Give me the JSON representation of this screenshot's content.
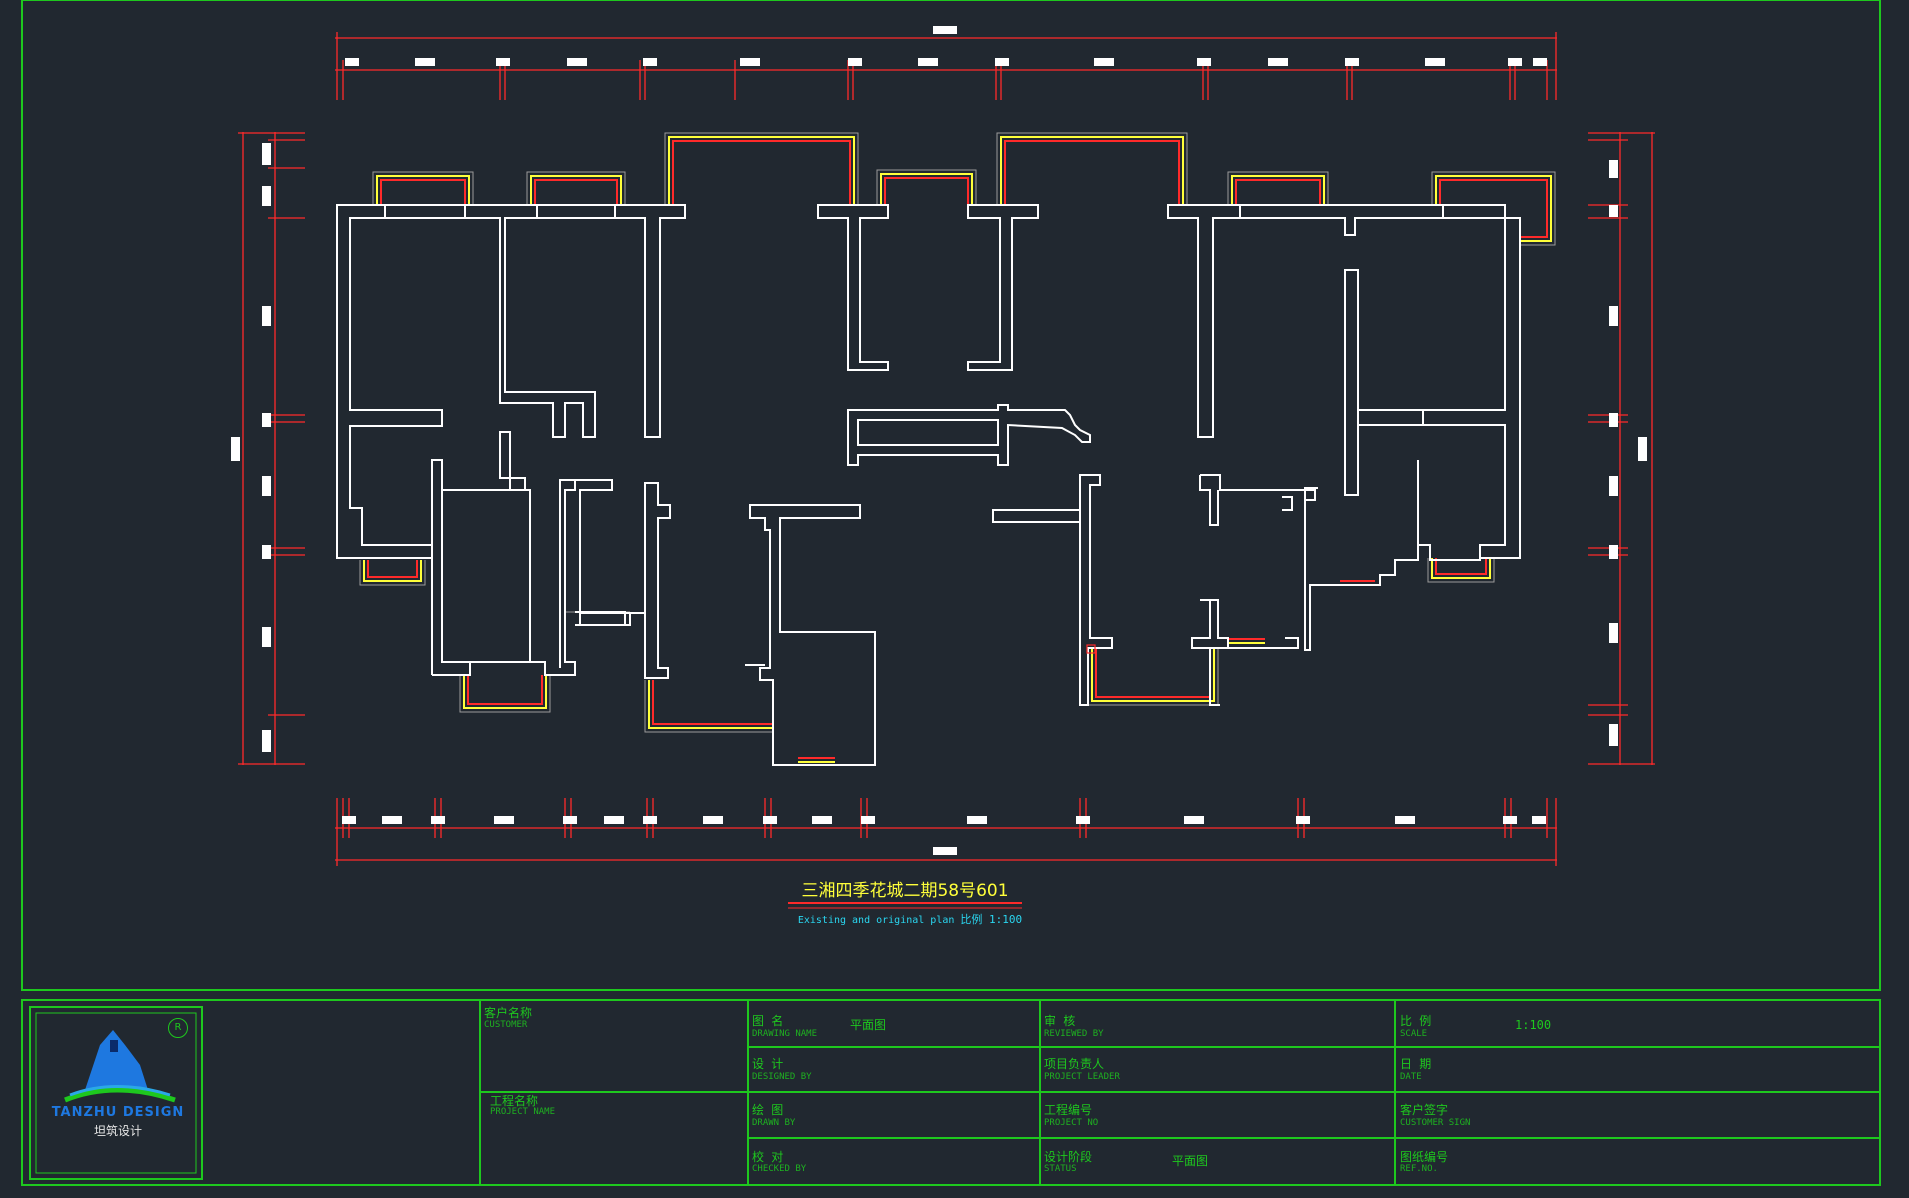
{
  "drawing": {
    "title": "三湘四季花城二期58号601",
    "subtitle": "Existing and original plan ",
    "scale_note": "比例 1:100"
  },
  "title_block": {
    "logo": {
      "brand": "TANZHU DESIGN",
      "brand_cn": "坦筑设计",
      "badge": "R"
    },
    "customer_label": "客户名称",
    "customer_label_en": "CUSTOMER",
    "project_label": "工程名称",
    "project_label_en": "PROJECT NAME",
    "rows": {
      "name_label": "图 名",
      "name_label_en": "DRAWING NAME",
      "name_value": "平面图",
      "designed_label": "设 计",
      "designed_label_en": "DESIGNED BY",
      "drawn_label": "绘 图",
      "drawn_label_en": "DRAWN BY",
      "checked_label": "校 对",
      "checked_label_en": "CHECKED BY",
      "reviewed_label": "审 核",
      "reviewed_label_en": "REVIEWED BY",
      "leader_label": "项目负责人",
      "leader_label_en": "PROJECT LEADER",
      "projno_label": "工程编号",
      "projno_label_en": "PROJECT NO",
      "status_label": "设计阶段",
      "status_label_en": "STATUS",
      "status_value": "平面图",
      "scale_label": "比 例",
      "scale_label_en": "SCALE",
      "scale_value": "1:100",
      "date_label": "日 期",
      "date_label_en": "DATE",
      "sign_label": "客户签字",
      "sign_label_en": "CUSTOMER SIGN",
      "refno_label": "图纸编号",
      "refno_label_en": "REF.NO."
    }
  },
  "colors": {
    "background": "#212830",
    "wall": "#ffffff",
    "dimension": "#ff2a2a",
    "window_outer": "#ffff3a",
    "frame": "#1ec81e",
    "title": "#ffff3a",
    "subtitle": "#2ad6f0"
  }
}
